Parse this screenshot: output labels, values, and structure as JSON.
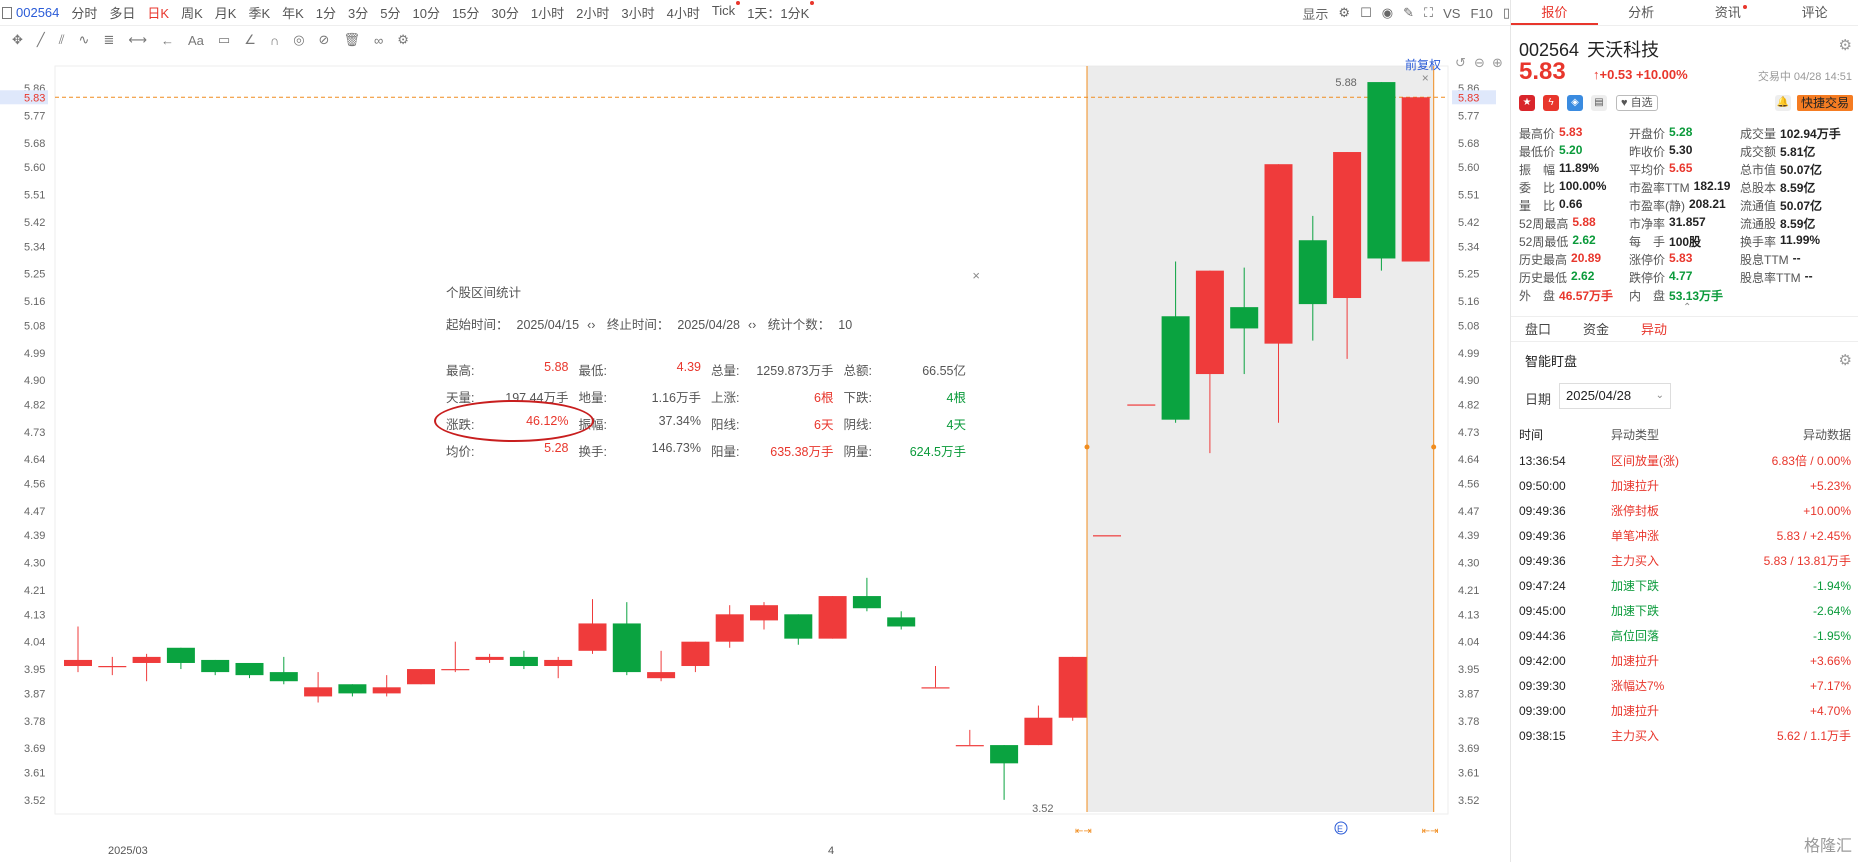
{
  "toolbar": {
    "code": "002564",
    "periods": [
      "分时",
      "多日",
      "日K",
      "周K",
      "月K",
      "季K",
      "年K",
      "1分",
      "3分",
      "5分",
      "10分",
      "15分",
      "30分",
      "1小时",
      "2小时",
      "3小时",
      "4小时",
      "Tick",
      "1天：1分K"
    ],
    "active_period": "日K",
    "right_items": [
      "显示",
      "VS",
      "F10"
    ]
  },
  "chart": {
    "restore_label": "前复权",
    "price_axis": [
      "5.86",
      "5.77",
      "5.68",
      "5.60",
      "5.51",
      "5.42",
      "5.34",
      "5.25",
      "5.16",
      "5.08",
      "4.99",
      "4.90",
      "4.82",
      "4.73",
      "4.64",
      "4.56",
      "4.47",
      "4.39",
      "4.30",
      "4.21",
      "4.13",
      "4.04",
      "3.95",
      "3.87",
      "3.78",
      "3.69",
      "3.61",
      "3.52"
    ],
    "current_price_tag": "5.83",
    "x_labels": [
      "2025/03",
      "4"
    ],
    "high_mark": "5.88",
    "low_mark": "3.52",
    "event_marker": "E",
    "colors": {
      "up": "#ef3b3b",
      "down": "#0aa340",
      "selection": "#e6e6e6",
      "orange": "#f08c1e"
    }
  },
  "chart_data": {
    "type": "candlestick",
    "candles": [
      {
        "o": 3.96,
        "c": 3.98,
        "h": 4.09,
        "l": 3.94
      },
      {
        "o": 3.96,
        "c": 3.96,
        "h": 3.99,
        "l": 3.93
      },
      {
        "o": 3.97,
        "c": 3.99,
        "h": 4.0,
        "l": 3.91
      },
      {
        "o": 4.02,
        "c": 3.97,
        "h": 4.02,
        "l": 3.95
      },
      {
        "o": 3.98,
        "c": 3.94,
        "h": 3.98,
        "l": 3.93
      },
      {
        "o": 3.97,
        "c": 3.93,
        "h": 3.97,
        "l": 3.92
      },
      {
        "o": 3.94,
        "c": 3.91,
        "h": 3.99,
        "l": 3.9
      },
      {
        "o": 3.86,
        "c": 3.89,
        "h": 3.94,
        "l": 3.84
      },
      {
        "o": 3.9,
        "c": 3.87,
        "h": 3.9,
        "l": 3.86
      },
      {
        "o": 3.87,
        "c": 3.89,
        "h": 3.93,
        "l": 3.86
      },
      {
        "o": 3.9,
        "c": 3.95,
        "h": 3.95,
        "l": 3.9
      },
      {
        "o": 3.95,
        "c": 3.95,
        "h": 4.04,
        "l": 3.94
      },
      {
        "o": 3.98,
        "c": 3.99,
        "h": 4.0,
        "l": 3.97
      },
      {
        "o": 3.99,
        "c": 3.96,
        "h": 4.01,
        "l": 3.95
      },
      {
        "o": 3.96,
        "c": 3.98,
        "h": 3.99,
        "l": 3.92
      },
      {
        "o": 4.01,
        "c": 4.1,
        "h": 4.18,
        "l": 4.0
      },
      {
        "o": 4.1,
        "c": 3.94,
        "h": 4.17,
        "l": 3.93
      },
      {
        "o": 3.92,
        "c": 3.94,
        "h": 4.01,
        "l": 3.91
      },
      {
        "o": 3.96,
        "c": 4.04,
        "h": 4.04,
        "l": 3.94
      },
      {
        "o": 4.04,
        "c": 4.13,
        "h": 4.16,
        "l": 4.02
      },
      {
        "o": 4.11,
        "c": 4.16,
        "h": 4.17,
        "l": 4.08
      },
      {
        "o": 4.13,
        "c": 4.05,
        "h": 4.13,
        "l": 4.03
      },
      {
        "o": 4.05,
        "c": 4.19,
        "h": 4.19,
        "l": 4.05
      },
      {
        "o": 4.19,
        "c": 4.15,
        "h": 4.25,
        "l": 4.14
      },
      {
        "o": 4.12,
        "c": 4.09,
        "h": 4.14,
        "l": 4.08
      },
      {
        "o": 3.89,
        "c": 3.89,
        "h": 3.96,
        "l": 3.89
      },
      {
        "o": 3.7,
        "c": 3.7,
        "h": 3.75,
        "l": 3.7
      },
      {
        "o": 3.7,
        "c": 3.64,
        "h": 3.7,
        "l": 3.52
      },
      {
        "o": 3.7,
        "c": 3.79,
        "h": 3.83,
        "l": 3.7
      },
      {
        "o": 3.79,
        "c": 3.99,
        "h": 3.99,
        "l": 3.78
      },
      {
        "o": 4.39,
        "c": 4.39,
        "h": 4.39,
        "l": 4.39
      },
      {
        "o": 4.82,
        "c": 4.82,
        "h": 4.82,
        "l": 4.82
      },
      {
        "o": 5.11,
        "c": 4.77,
        "h": 5.29,
        "l": 4.76
      },
      {
        "o": 4.92,
        "c": 5.26,
        "h": 5.26,
        "l": 4.66
      },
      {
        "o": 5.14,
        "c": 5.07,
        "h": 5.27,
        "l": 4.92
      },
      {
        "o": 5.02,
        "c": 5.61,
        "h": 5.61,
        "l": 4.76
      },
      {
        "o": 5.36,
        "c": 5.15,
        "h": 5.44,
        "l": 5.03
      },
      {
        "o": 5.17,
        "c": 5.65,
        "h": 5.65,
        "l": 4.97
      },
      {
        "o": 5.88,
        "c": 5.3,
        "h": 5.88,
        "l": 5.26
      },
      {
        "o": 5.29,
        "c": 5.83,
        "h": 5.83,
        "l": 5.29
      }
    ],
    "ylim": [
      3.48,
      5.9
    ]
  },
  "stats": {
    "title": "个股区间统计",
    "start_label": "起始时间：",
    "start_date": "2025/04/15",
    "end_label": "终止时间：",
    "end_date": "2025/04/28",
    "count_label": "统计个数：",
    "count": "10",
    "rows": [
      [
        [
          "最高:",
          "5.88",
          "red"
        ],
        [
          "最低:",
          "4.39",
          "red"
        ],
        [
          "总量:",
          "1259.873万手",
          ""
        ],
        [
          "总额:",
          "66.55亿",
          ""
        ]
      ],
      [
        [
          "天量:",
          "197.44万手",
          ""
        ],
        [
          "地量:",
          "1.16万手",
          ""
        ],
        [
          "上涨:",
          "6根",
          "red"
        ],
        [
          "下跌:",
          "4根",
          "green"
        ]
      ],
      [
        [
          "涨跌:",
          "46.12%",
          "red"
        ],
        [
          "振幅:",
          "37.34%",
          ""
        ],
        [
          "阳线:",
          "6天",
          "red"
        ],
        [
          "阴线:",
          "4天",
          "green"
        ]
      ],
      [
        [
          "均价:",
          "5.28",
          "red"
        ],
        [
          "换手:",
          "146.73%",
          ""
        ],
        [
          "阳量:",
          "635.38万手",
          "red"
        ],
        [
          "阴量:",
          "624.5万手",
          "green"
        ]
      ]
    ]
  },
  "panel": {
    "tabs": [
      "报价",
      "分析",
      "资讯",
      "评论"
    ],
    "code": "002564",
    "name": "天沃科技",
    "price": "5.83",
    "change": "+0.53 +10.00%",
    "trade_status": "交易中 04/28 14:51",
    "watch_label": "自选",
    "quick_trade": "快捷交易",
    "quote_rows": [
      [
        [
          "最高价",
          "5.83",
          "red"
        ],
        [
          "开盘价",
          "5.28",
          "green"
        ],
        [
          "成交量",
          "102.94万手",
          ""
        ]
      ],
      [
        [
          "最低价",
          "5.20",
          "green"
        ],
        [
          "昨收价",
          "5.30",
          ""
        ],
        [
          "成交额",
          "5.81亿",
          ""
        ]
      ],
      [
        [
          "振　幅",
          "11.89%",
          ""
        ],
        [
          "平均价",
          "5.65",
          "red"
        ],
        [
          "总市值",
          "50.07亿",
          ""
        ]
      ],
      [
        [
          "委　比",
          "100.00%",
          ""
        ],
        [
          "市盈率TTM",
          "182.19",
          ""
        ],
        [
          "总股本",
          "8.59亿",
          ""
        ]
      ],
      [
        [
          "量　比",
          "0.66",
          ""
        ],
        [
          "市盈率(静)",
          "208.21",
          ""
        ],
        [
          "流通值",
          "50.07亿",
          ""
        ]
      ],
      [
        [
          "52周最高",
          "5.88",
          "red"
        ],
        [
          "市净率",
          "31.857",
          ""
        ],
        [
          "流通股",
          "8.59亿",
          ""
        ]
      ],
      [
        [
          "52周最低",
          "2.62",
          "green"
        ],
        [
          "每　手",
          "100股",
          ""
        ],
        [
          "换手率",
          "11.99%",
          ""
        ]
      ],
      [
        [
          "历史最高",
          "20.89",
          "red"
        ],
        [
          "涨停价",
          "5.83",
          "red"
        ],
        [
          "股息TTM",
          "--",
          ""
        ]
      ],
      [
        [
          "历史最低",
          "2.62",
          "green"
        ],
        [
          "跌停价",
          "4.77",
          "green"
        ],
        [
          "股息率TTM",
          "--",
          ""
        ]
      ],
      [
        [
          "外　盘",
          "46.57万手",
          "red"
        ],
        [
          "内　盘",
          "53.13万手",
          "green"
        ],
        [
          "",
          "",
          ""
        ]
      ]
    ],
    "subtabs": [
      "盘口",
      "资金",
      "异动"
    ],
    "watch_title": "智能盯盘",
    "date_label": "日期",
    "date_value": "2025/04/28",
    "alert_headers": [
      "时间",
      "异动类型",
      "异动数据"
    ],
    "alerts": [
      [
        "13:36:54",
        "区间放量(涨)",
        "6.83倍 / 0.00%",
        "red"
      ],
      [
        "09:50:00",
        "加速拉升",
        "+5.23%",
        "red"
      ],
      [
        "09:49:36",
        "涨停封板",
        "+10.00%",
        "red"
      ],
      [
        "09:49:36",
        "单笔冲涨",
        "5.83 / +2.45%",
        "red"
      ],
      [
        "09:49:36",
        "主力买入",
        "5.83 / 13.81万手",
        "red"
      ],
      [
        "09:47:24",
        "加速下跌",
        "-1.94%",
        "green"
      ],
      [
        "09:45:00",
        "加速下跌",
        "-2.64%",
        "green"
      ],
      [
        "09:44:36",
        "高位回落",
        "-1.95%",
        "green"
      ],
      [
        "09:42:00",
        "加速拉升",
        "+3.66%",
        "red"
      ],
      [
        "09:39:30",
        "涨幅达7%",
        "+7.17%",
        "red"
      ],
      [
        "09:39:00",
        "加速拉升",
        "+4.70%",
        "red"
      ],
      [
        "09:38:15",
        "主力买入",
        "5.62 / 1.1万手",
        "red"
      ]
    ],
    "watermark": "格隆汇"
  }
}
